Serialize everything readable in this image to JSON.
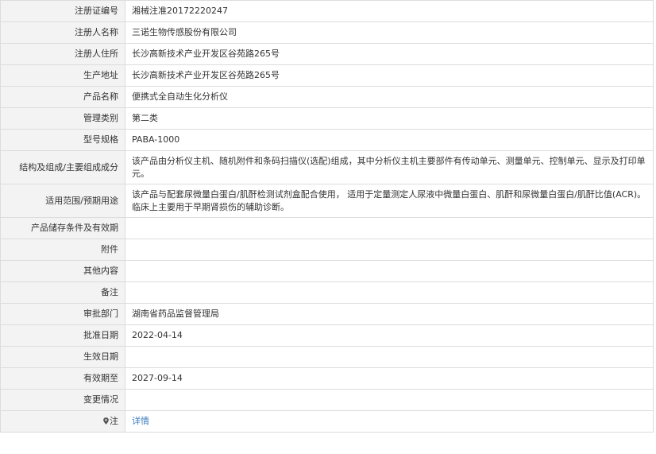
{
  "rows": [
    {
      "label": "注册证编号",
      "value": "湘械注准20172220247"
    },
    {
      "label": "注册人名称",
      "value": "三诺生物传感股份有限公司"
    },
    {
      "label": "注册人住所",
      "value": "长沙高新技术产业开发区谷苑路265号"
    },
    {
      "label": "生产地址",
      "value": "长沙高新技术产业开发区谷苑路265号"
    },
    {
      "label": "产品名称",
      "value": "便携式全自动生化分析仪"
    },
    {
      "label": "管理类别",
      "value": "第二类"
    },
    {
      "label": "型号规格",
      "value": "PABA-1000"
    },
    {
      "label": "结构及组成/主要组成成分",
      "value": "该产品由分析仪主机、随机附件和条码扫描仪(选配)组成，其中分析仪主机主要部件有传动单元、测量单元、控制单元、显示及打印单元。"
    },
    {
      "label": "适用范围/预期用途",
      "value": "该产品与配套尿微量白蛋白/肌酐检测试剂盒配合使用， 适用于定量测定人尿液中微量白蛋白、肌酐和尿微量白蛋白/肌酐比值(ACR)。临床上主要用于早期肾损伤的辅助诊断。"
    },
    {
      "label": "产品储存条件及有效期",
      "value": ""
    },
    {
      "label": "附件",
      "value": ""
    },
    {
      "label": "其他内容",
      "value": ""
    },
    {
      "label": "备注",
      "value": ""
    },
    {
      "label": "审批部门",
      "value": "湖南省药品监督管理局"
    },
    {
      "label": "批准日期",
      "value": "2022-04-14"
    },
    {
      "label": "生效日期",
      "value": ""
    },
    {
      "label": "有效期至",
      "value": "2027-09-14"
    },
    {
      "label": "变更情况",
      "value": ""
    }
  ],
  "note": {
    "label": "注",
    "icon": "map-pin-icon",
    "link_text": "详情"
  },
  "colors": {
    "label_bg": "#f3f3f3",
    "border": "#dcdcdc",
    "link": "#3b7bbf",
    "text": "#333333"
  }
}
